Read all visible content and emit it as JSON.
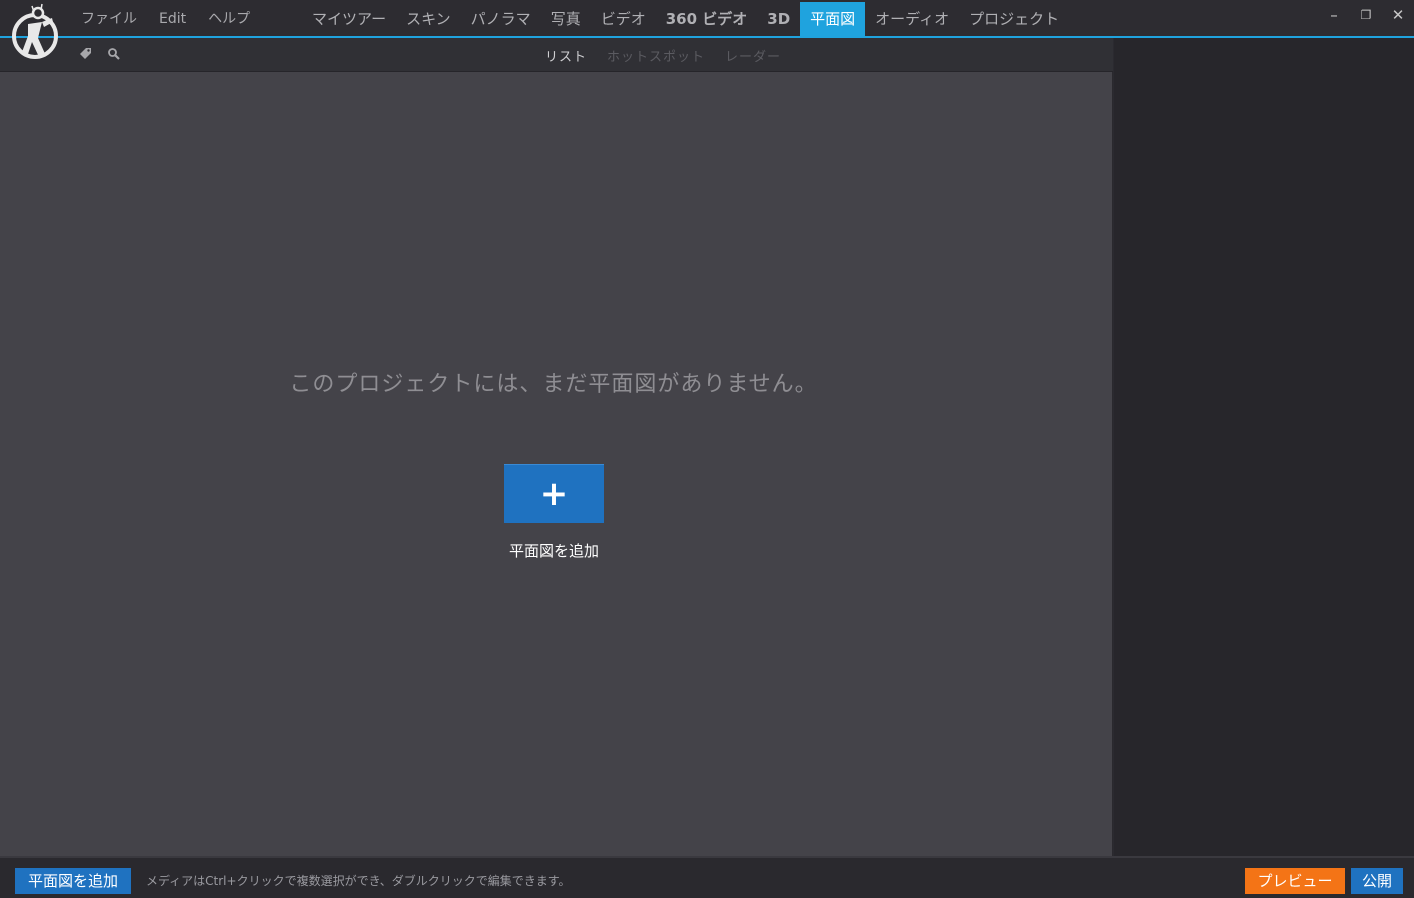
{
  "menu": {
    "file": "ファイル",
    "edit": "Edit",
    "help": "ヘルプ"
  },
  "main_tabs": [
    {
      "label": "マイツアー",
      "active": false
    },
    {
      "label": "スキン",
      "active": false
    },
    {
      "label": "パノラマ",
      "active": false
    },
    {
      "label": "写真",
      "active": false
    },
    {
      "label": "ビデオ",
      "active": false
    },
    {
      "label": "360 ビデオ",
      "active": false
    },
    {
      "label": "3D",
      "active": false
    },
    {
      "label": "平面図",
      "active": true
    },
    {
      "label": "オーディオ",
      "active": false
    },
    {
      "label": "プロジェクト",
      "active": false
    }
  ],
  "window_controls": {
    "minimize": "–",
    "restore": "❐",
    "close": "✕"
  },
  "toolbar": {
    "icons": [
      "tag-icon",
      "search-icon"
    ]
  },
  "sub_tabs": [
    {
      "label": "リスト",
      "active": true
    },
    {
      "label": "ホットスポット",
      "active": false
    },
    {
      "label": "レーダー",
      "active": false
    }
  ],
  "content": {
    "empty_message": "このプロジェクトには、まだ平面図がありません。",
    "add_button_icon": "+",
    "add_button_label": "平面図を追加"
  },
  "bottom": {
    "add_label": "平面図を追加",
    "hint": "メディアはCtrl+クリックで複数選択ができ、ダブルクリックで編集できます。",
    "preview_label": "プレビュー",
    "publish_label": "公開"
  },
  "colors": {
    "accent_blue": "#1fa3de",
    "button_blue": "#1f72c0",
    "preview_orange": "#f47416",
    "content_bg": "#444349",
    "panel_bg": "#27262b"
  }
}
